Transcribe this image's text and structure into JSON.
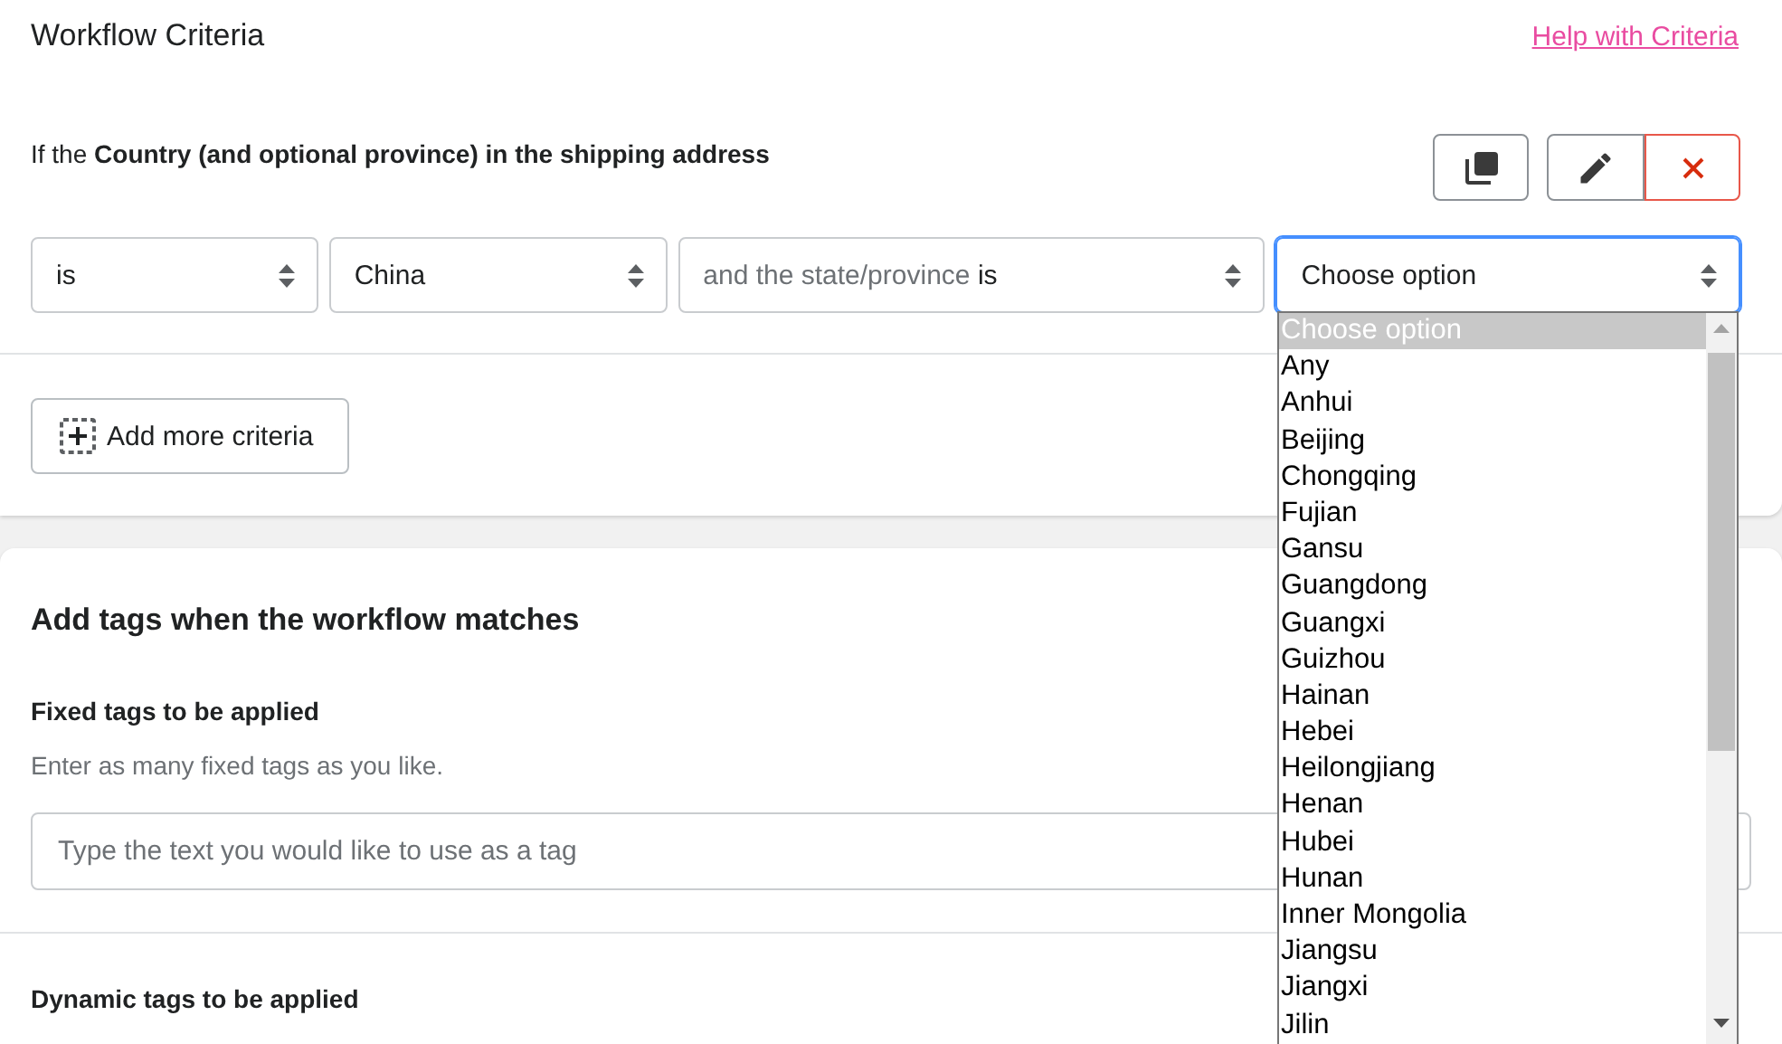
{
  "criteria_card": {
    "title": "Workflow Criteria",
    "help_link": "Help with Criteria",
    "condition": "If the **Country (and optional province) in the shipping address**",
    "actions": [
      {
        "kind": "copy"
      },
      {
        "kind": "edit"
      },
      {
        "kind": "delete"
      }
    ],
    "selects": [
      {
        "value": "is"
      },
      {
        "value": "China"
      },
      {
        "prefix": "and the state/province",
        "value": "is"
      },
      {
        "value": "Choose option",
        "focused": true
      }
    ],
    "add_button": "Add more criteria"
  },
  "dropdown": {
    "options": [
      {
        "label": "Choose option",
        "selected": true
      },
      {
        "label": "Any",
        "selected": false
      },
      {
        "label": "Anhui",
        "selected": false
      },
      {
        "label": "Beijing",
        "selected": false
      },
      {
        "label": "Chongqing",
        "selected": false
      },
      {
        "label": "Fujian",
        "selected": false
      },
      {
        "label": "Gansu",
        "selected": false
      },
      {
        "label": "Guangdong",
        "selected": false
      },
      {
        "label": "Guangxi",
        "selected": false
      },
      {
        "label": "Guizhou",
        "selected": false
      },
      {
        "label": "Hainan",
        "selected": false
      },
      {
        "label": "Hebei",
        "selected": false
      },
      {
        "label": "Heilongjiang",
        "selected": false
      },
      {
        "label": "Henan",
        "selected": false
      },
      {
        "label": "Hubei",
        "selected": false
      },
      {
        "label": "Hunan",
        "selected": false
      },
      {
        "label": "Inner Mongolia",
        "selected": false
      },
      {
        "label": "Jiangsu",
        "selected": false
      },
      {
        "label": "Jiangxi",
        "selected": false
      },
      {
        "label": "Jilin",
        "selected": false
      }
    ]
  },
  "tags_card": {
    "title": "Add tags when the workflow matches",
    "fixed_label": "Fixed tags to be applied",
    "fixed_hint": "Enter as many fixed tags as you like.",
    "tag_input": {
      "placeholder": "Type the text you would like to use as a tag"
    },
    "dynamic_label": "Dynamic tags to be applied"
  }
}
